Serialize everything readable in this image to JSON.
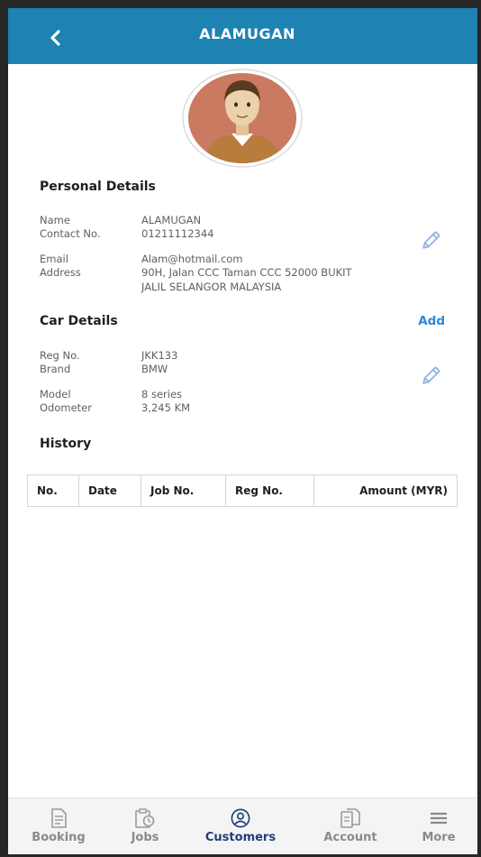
{
  "header": {
    "title": "ALAMUGAN"
  },
  "personal": {
    "section_title": "Personal Details",
    "name_label": "Name",
    "name_value": "ALAMUGAN",
    "contact_label": "Contact No.",
    "contact_value": "01211112344",
    "email_label": "Email",
    "email_value": "Alam@hotmail.com",
    "address_label": "Address",
    "address_line1": "90H, Jalan CCC Taman CCC 52000 BUKIT",
    "address_line2": "JALIL SELANGOR MALAYSIA"
  },
  "car": {
    "section_title": "Car Details",
    "add_label": "Add",
    "reg_label": "Reg No.",
    "reg_value": "JKK133",
    "brand_label": "Brand",
    "brand_value": "BMW",
    "model_label": "Model",
    "model_value": "8 series",
    "odometer_label": "Odometer",
    "odometer_value": "3,245 KM"
  },
  "history": {
    "section_title": "History",
    "columns": [
      "No.",
      "Date",
      "Job No.",
      "Reg No.",
      "Amount (MYR)"
    ]
  },
  "nav": {
    "items": [
      {
        "label": "Booking",
        "icon": "booking-document-icon"
      },
      {
        "label": "Jobs",
        "icon": "jobs-clipboard-clock-icon"
      },
      {
        "label": "Customers",
        "icon": "customers-user-circle-icon"
      },
      {
        "label": "Account",
        "icon": "account-documents-icon"
      },
      {
        "label": "More",
        "icon": "hamburger-menu-icon"
      }
    ],
    "active": "Customers"
  },
  "colors": {
    "header": "#1e82b2",
    "accent_link": "#2f86d8",
    "nav_active": "#1f3f7a",
    "nav_inactive": "#8a8a8a",
    "edit_icon": "#8fb4df"
  }
}
